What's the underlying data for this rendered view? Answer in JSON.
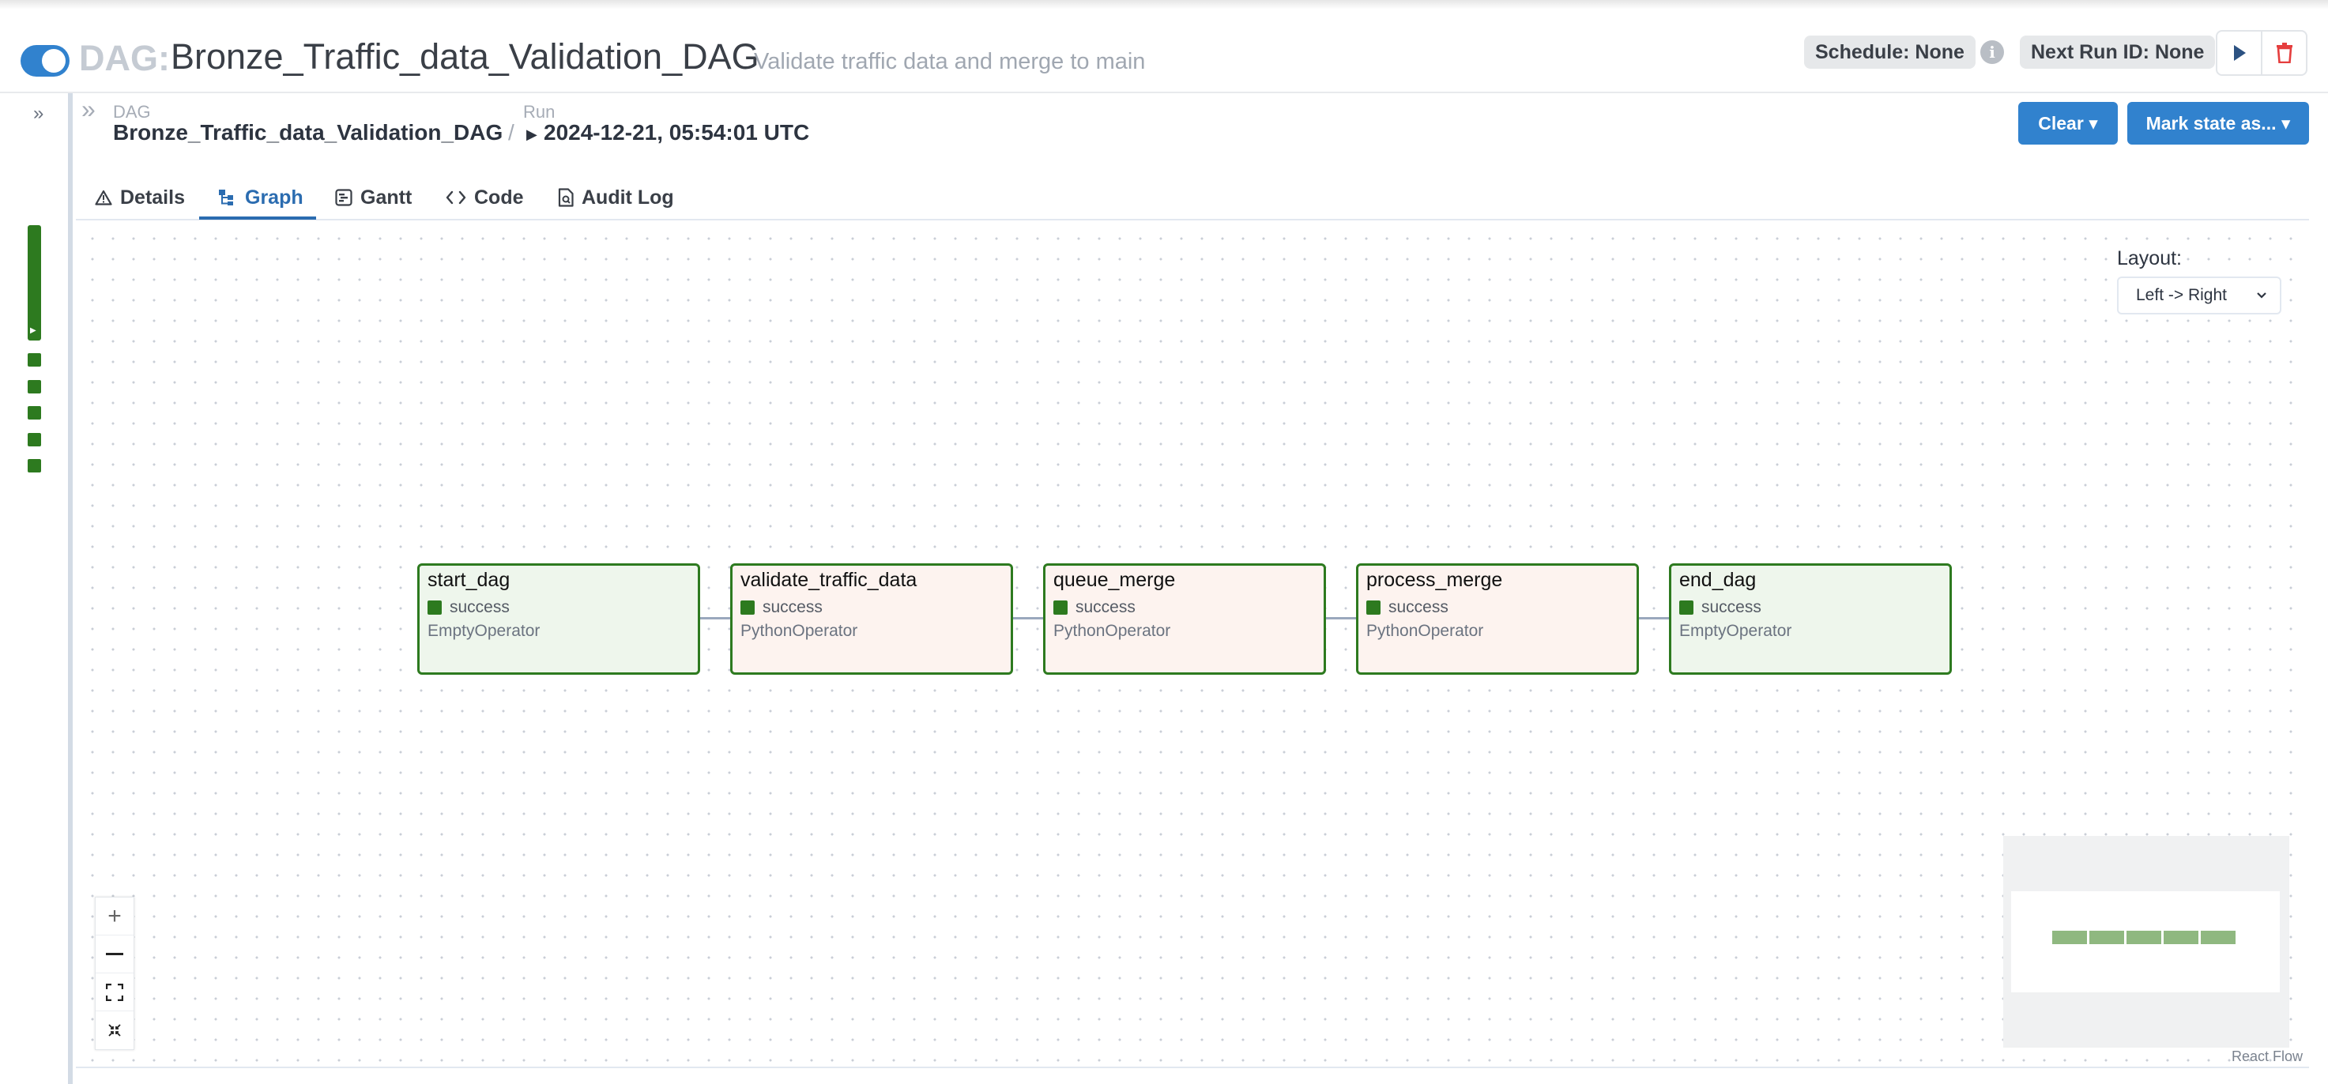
{
  "header": {
    "dag_prefix": "DAG:",
    "dag_id": "Bronze_Traffic_data_Validation_DAG",
    "description": "Validate traffic data and merge to main",
    "schedule": "Schedule: None",
    "next_run": "Next Run ID: None",
    "paused": false
  },
  "breadcrumb": {
    "dag_label": "DAG",
    "dag_name": "Bronze_Traffic_data_Validation_DAG",
    "separator": "/",
    "run_label": "Run",
    "run_value": "2024-12-21, 05:54:01 UTC"
  },
  "actions": {
    "clear": "Clear",
    "mark_state": "Mark state as..."
  },
  "tabs": [
    {
      "label": "Details",
      "icon": "warning-triangle-icon"
    },
    {
      "label": "Graph",
      "icon": "graph-icon",
      "active": true
    },
    {
      "label": "Gantt",
      "icon": "gantt-icon"
    },
    {
      "label": "Code",
      "icon": "code-icon"
    },
    {
      "label": "Audit Log",
      "icon": "document-icon"
    }
  ],
  "layout": {
    "label": "Layout:",
    "value": "Left -> Right"
  },
  "nodes": [
    {
      "name": "start_dag",
      "state": "success",
      "operator": "EmptyOperator"
    },
    {
      "name": "validate_traffic_data",
      "state": "success",
      "operator": "PythonOperator"
    },
    {
      "name": "queue_merge",
      "state": "success",
      "operator": "PythonOperator"
    },
    {
      "name": "process_merge",
      "state": "success",
      "operator": "PythonOperator"
    },
    {
      "name": "end_dag",
      "state": "success",
      "operator": "EmptyOperator"
    }
  ],
  "footer": {
    "attribution": "React Flow"
  },
  "colors": {
    "success": "#2d7a1f",
    "accent": "#3182ce",
    "empty_operator_bg": "#eef6ec",
    "python_operator_bg": "#fdf3ef"
  }
}
